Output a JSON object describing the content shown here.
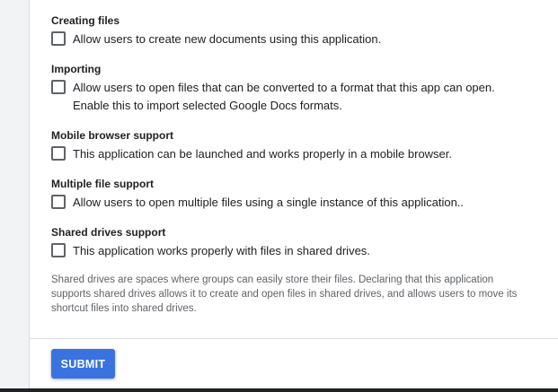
{
  "sections": [
    {
      "title": "Creating files",
      "option": "Allow users to create new documents using this application."
    },
    {
      "title": "Importing",
      "option_line1": "Allow users to open files that can be converted to a format that this app can open.",
      "option_line2": "Enable this to import selected Google Docs formats."
    },
    {
      "title": "Mobile browser support",
      "option": "This application can be launched and works properly in a mobile browser."
    },
    {
      "title": "Multiple file support",
      "option": "Allow users to open multiple files using a single instance of this application.."
    },
    {
      "title": "Shared drives support",
      "option": "This application works properly with files in shared drives."
    }
  ],
  "help_text": "Shared drives are spaces where groups can easily store their files. Declaring that this application supports shared drives allows it to create and open files in shared drives, and allows users to move its shortcut files into shared drives.",
  "submit_label": "SUBMIT",
  "colors": {
    "accent": "#3a73e0",
    "text": "#202124",
    "muted": "#5f6368",
    "divider": "#dadce0"
  }
}
